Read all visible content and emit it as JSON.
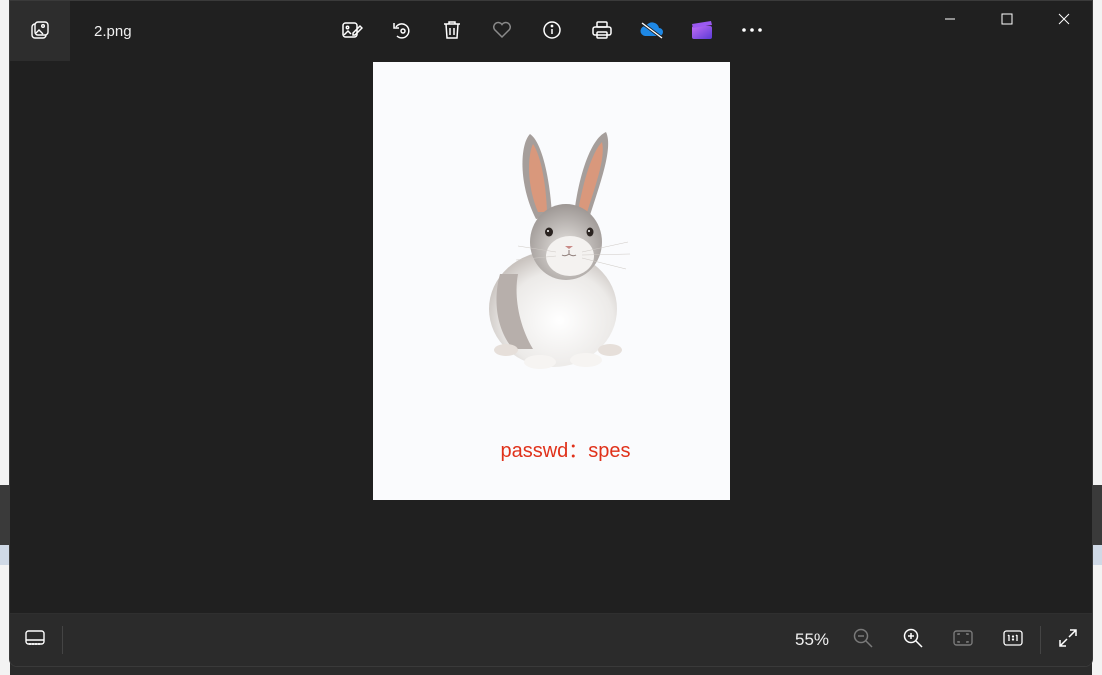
{
  "title_bar": {
    "file_name": "2.png"
  },
  "toolbar": {
    "buttons": [
      {
        "icon": "edit-image-icon",
        "label": "Edit image"
      },
      {
        "icon": "rotate-icon",
        "label": "Rotate"
      },
      {
        "icon": "delete-icon",
        "label": "Delete"
      },
      {
        "icon": "heart-icon",
        "label": "Favorite"
      },
      {
        "icon": "info-icon",
        "label": "File information"
      },
      {
        "icon": "print-icon",
        "label": "Print"
      },
      {
        "icon": "onedrive-off-icon",
        "label": "OneDrive"
      },
      {
        "icon": "clipchamp-icon",
        "label": "Clipchamp"
      },
      {
        "icon": "more-icon",
        "label": "See more"
      }
    ]
  },
  "window_controls": [
    "minimize-icon",
    "maximize-icon",
    "close-icon"
  ],
  "photo": {
    "subject": "rabbit",
    "caption": "passwd：spes",
    "caption_color": "#e0311a"
  },
  "statusbar": {
    "zoom": "55%"
  },
  "colors": {
    "window_bg": "#202020",
    "statusbar_bg": "#2b2b2b",
    "photo_bg": "#fafbfd"
  }
}
